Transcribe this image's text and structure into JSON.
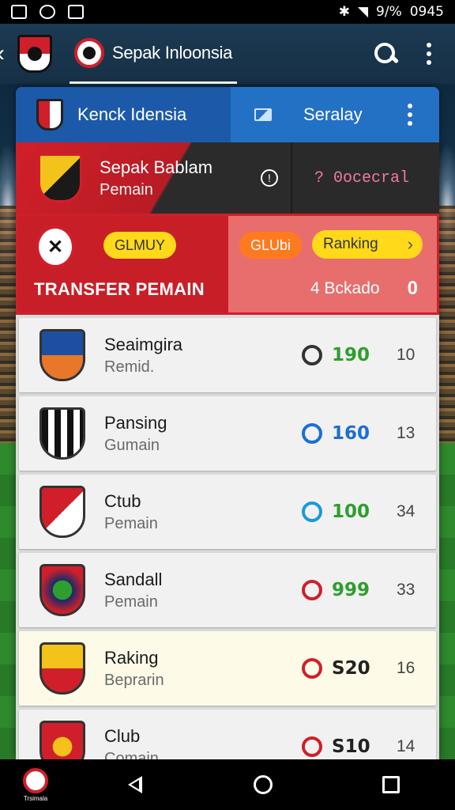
{
  "status_bar": {
    "time": "0945",
    "battery": "9/%"
  },
  "app_bar": {
    "title": "Sepak Inloonsia"
  },
  "card_header": {
    "title": "Kenck Idensia",
    "tab": "Seralay"
  },
  "featured": {
    "name": "Sepak Bablam",
    "sub": "Pemain",
    "right_label": "? 0ocecral"
  },
  "transfer": {
    "pill_club": "GLMUY",
    "title": "TRANSFER  PEMAIN",
    "pill_club2": "GLUbi",
    "pill_rank": "Ranking",
    "stat": "4 Bckado",
    "count": "0"
  },
  "clubs": [
    {
      "name": "Seaimgira",
      "sub": "Remid.",
      "score": "190",
      "rank": "10",
      "score_color": "#2e9e2e",
      "icon_color": "#333333"
    },
    {
      "name": "Pansing",
      "sub": "Gumain",
      "score": "160",
      "rank": "13",
      "score_color": "#1d6fd1",
      "icon_color": "#1d6fd1"
    },
    {
      "name": "Ctub",
      "sub": "Pemain",
      "score": "100",
      "rank": "34",
      "score_color": "#2e9e2e",
      "icon_color": "#1a9bd7"
    },
    {
      "name": "Sandall",
      "sub": "Pemain",
      "score": "999",
      "rank": "33",
      "score_color": "#2e9e2e",
      "icon_color": "#d01f2a"
    },
    {
      "name": "Raking",
      "sub": "Beprarin",
      "score": "S20",
      "rank": "16",
      "score_color": "#222222",
      "icon_color": "#d01f2a"
    },
    {
      "name": "Club",
      "sub": "Comain",
      "score": "S10",
      "rank": "14",
      "score_color": "#222222",
      "icon_color": "#d01f2a"
    }
  ],
  "nav_bar": {
    "app_label": "Trsimala"
  },
  "colors": {
    "brand_red": "#d01f2a",
    "header_blue": "#1c5aa9",
    "accent_yellow": "#ffd91a"
  }
}
